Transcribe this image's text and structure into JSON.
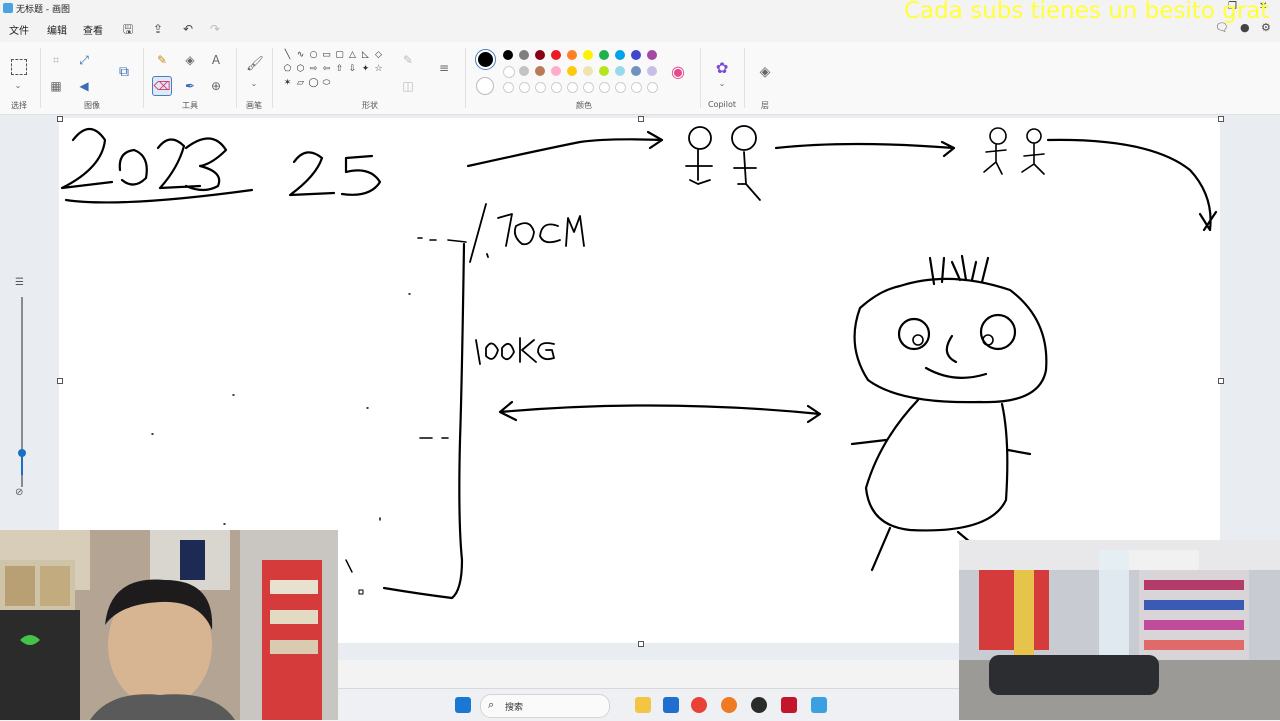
{
  "window": {
    "title": "无标题 - 画图",
    "overlay_text": "Cada subs tienes un besito grat"
  },
  "menu": {
    "file": "文件",
    "edit": "编辑",
    "view": "查看"
  },
  "ribbon": {
    "groups": {
      "select": "选择",
      "image": "图像",
      "tools": "工具",
      "brushes": "画笔",
      "shapes": "形状",
      "colors": "颜色",
      "copilot": "Copilot",
      "layers": "层"
    },
    "colors": {
      "current": "#000000",
      "row1": [
        "#000000",
        "#7f7f7f",
        "#880015",
        "#ed1c24",
        "#ff7f27",
        "#fff200",
        "#22b14c",
        "#00a2e8",
        "#3f48cc",
        "#a349a4"
      ],
      "row2": [
        "#ffffff",
        "#c3c3c3",
        "#b97a57",
        "#ffaec9",
        "#ffc90e",
        "#efe4b0",
        "#b5e61d",
        "#99d9ea",
        "#7092be",
        "#c8bfe7"
      ]
    },
    "shape_glyphs": [
      "╲",
      "∿",
      "○",
      "▭",
      "▢",
      "△",
      "◺",
      "◇",
      "⬠",
      "⬡",
      "⇨",
      "⇦",
      "⇧",
      "⇩",
      "✦",
      "☆",
      "✶",
      "▱",
      "◯",
      "⬭"
    ]
  },
  "canvas": {
    "handwriting": {
      "year": "2023",
      "age": "25",
      "height": "1.70CM",
      "weight": "100KG"
    }
  },
  "taskbar": {
    "search_placeholder": "搜索"
  }
}
